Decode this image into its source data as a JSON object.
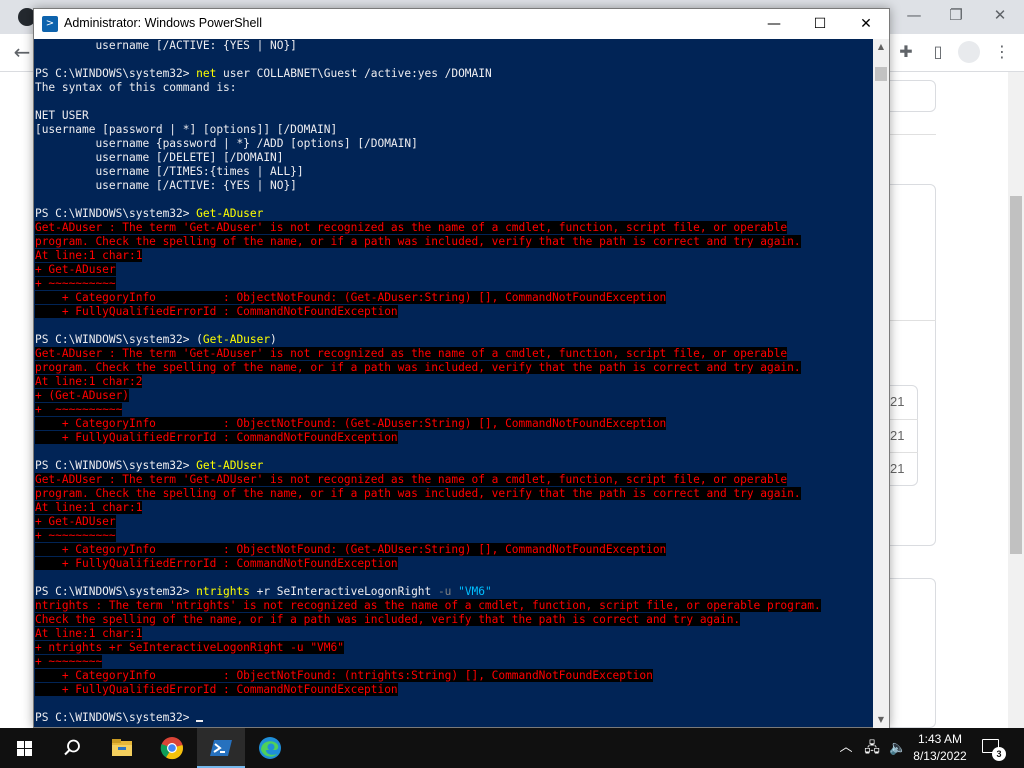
{
  "powershell": {
    "title": "Administrator: Windows PowerShell",
    "lines": [
      [
        {
          "t": "         username [/ACTIVE: {YES | NO}]",
          "c": "norm"
        }
      ],
      [
        {
          "t": "",
          "c": "norm"
        }
      ],
      [
        {
          "t": "PS C:\\WINDOWS\\system32> ",
          "c": "norm"
        },
        {
          "t": "net",
          "c": "cmd"
        },
        {
          "t": " user COLLABNET\\Guest /active:yes /DOMAIN",
          "c": "norm"
        }
      ],
      [
        {
          "t": "The syntax of this command is:",
          "c": "norm"
        }
      ],
      [
        {
          "t": "",
          "c": "norm"
        }
      ],
      [
        {
          "t": "NET USER",
          "c": "norm"
        }
      ],
      [
        {
          "t": "[username [password | *] [options]] [/DOMAIN]",
          "c": "norm"
        }
      ],
      [
        {
          "t": "         username {password | *} /ADD [options] [/DOMAIN]",
          "c": "norm"
        }
      ],
      [
        {
          "t": "         username [/DELETE] [/DOMAIN]",
          "c": "norm"
        }
      ],
      [
        {
          "t": "         username [/TIMES:{times | ALL}]",
          "c": "norm"
        }
      ],
      [
        {
          "t": "         username [/ACTIVE: {YES | NO}]",
          "c": "norm"
        }
      ],
      [
        {
          "t": "",
          "c": "norm"
        }
      ],
      [
        {
          "t": "PS C:\\WINDOWS\\system32> ",
          "c": "norm"
        },
        {
          "t": "Get-ADuser",
          "c": "cmd"
        }
      ],
      [
        {
          "t": "Get-ADuser : The term 'Get-ADuser' is not recognized as the name of a cmdlet, function, script file, or operable",
          "c": "err"
        }
      ],
      [
        {
          "t": "program. Check the spelling of the name, or if a path was included, verify that the path is correct and try again.",
          "c": "err"
        }
      ],
      [
        {
          "t": "At line:1 char:1",
          "c": "err"
        }
      ],
      [
        {
          "t": "+ Get-ADuser",
          "c": "err"
        }
      ],
      [
        {
          "t": "+ ~~~~~~~~~~",
          "c": "err"
        }
      ],
      [
        {
          "t": "    + CategoryInfo          : ObjectNotFound: (Get-ADuser:String) [], CommandNotFoundException",
          "c": "err"
        }
      ],
      [
        {
          "t": "    + FullyQualifiedErrorId : CommandNotFoundException",
          "c": "err"
        }
      ],
      [
        {
          "t": "",
          "c": "norm"
        }
      ],
      [
        {
          "t": "PS C:\\WINDOWS\\system32> (",
          "c": "norm"
        },
        {
          "t": "Get-ADuser",
          "c": "cmd"
        },
        {
          "t": ")",
          "c": "norm"
        }
      ],
      [
        {
          "t": "Get-ADuser : The term 'Get-ADuser' is not recognized as the name of a cmdlet, function, script file, or operable",
          "c": "err"
        }
      ],
      [
        {
          "t": "program. Check the spelling of the name, or if a path was included, verify that the path is correct and try again.",
          "c": "err"
        }
      ],
      [
        {
          "t": "At line:1 char:2",
          "c": "err"
        }
      ],
      [
        {
          "t": "+ (Get-ADuser)",
          "c": "err"
        }
      ],
      [
        {
          "t": "+  ~~~~~~~~~~",
          "c": "err"
        }
      ],
      [
        {
          "t": "    + CategoryInfo          : ObjectNotFound: (Get-ADuser:String) [], CommandNotFoundException",
          "c": "err"
        }
      ],
      [
        {
          "t": "    + FullyQualifiedErrorId : CommandNotFoundException",
          "c": "err"
        }
      ],
      [
        {
          "t": "",
          "c": "norm"
        }
      ],
      [
        {
          "t": "PS C:\\WINDOWS\\system32> ",
          "c": "norm"
        },
        {
          "t": "Get-ADUser",
          "c": "cmd"
        }
      ],
      [
        {
          "t": "Get-ADUser : The term 'Get-ADUser' is not recognized as the name of a cmdlet, function, script file, or operable",
          "c": "err"
        }
      ],
      [
        {
          "t": "program. Check the spelling of the name, or if a path was included, verify that the path is correct and try again.",
          "c": "err"
        }
      ],
      [
        {
          "t": "At line:1 char:1",
          "c": "err"
        }
      ],
      [
        {
          "t": "+ Get-ADUser",
          "c": "err"
        }
      ],
      [
        {
          "t": "+ ~~~~~~~~~~",
          "c": "err"
        }
      ],
      [
        {
          "t": "    + CategoryInfo          : ObjectNotFound: (Get-ADUser:String) [], CommandNotFoundException",
          "c": "err"
        }
      ],
      [
        {
          "t": "    + FullyQualifiedErrorId : CommandNotFoundException",
          "c": "err"
        }
      ],
      [
        {
          "t": "",
          "c": "norm"
        }
      ],
      [
        {
          "t": "PS C:\\WINDOWS\\system32> ",
          "c": "norm"
        },
        {
          "t": "ntrights",
          "c": "cmd"
        },
        {
          "t": " +r SeInteractiveLogonRight ",
          "c": "norm"
        },
        {
          "t": "-u",
          "c": "param"
        },
        {
          "t": " ",
          "c": "norm"
        },
        {
          "t": "\"VM6\"",
          "c": "str"
        }
      ],
      [
        {
          "t": "ntrights : The term 'ntrights' is not recognized as the name of a cmdlet, function, script file, or operable program.",
          "c": "err"
        }
      ],
      [
        {
          "t": "Check the spelling of the name, or if a path was included, verify that the path is correct and try again.",
          "c": "err"
        }
      ],
      [
        {
          "t": "At line:1 char:1",
          "c": "err"
        }
      ],
      [
        {
          "t": "+ ntrights +r SeInteractiveLogonRight -u \"VM6\"",
          "c": "err"
        }
      ],
      [
        {
          "t": "+ ~~~~~~~~",
          "c": "err"
        }
      ],
      [
        {
          "t": "    + CategoryInfo          : ObjectNotFound: (ntrights:String) [], CommandNotFoundException",
          "c": "err"
        }
      ],
      [
        {
          "t": "    + FullyQualifiedErrorId : CommandNotFoundException",
          "c": "err"
        }
      ],
      [
        {
          "t": "",
          "c": "norm"
        }
      ],
      [
        {
          "t": "PS C:\\WINDOWS\\system32> ",
          "c": "norm"
        }
      ]
    ],
    "buttons": {
      "minimize": "—",
      "maximize": "☐",
      "close": "✕"
    },
    "scroll": {
      "up": "▲",
      "down": "▼"
    },
    "colors": {
      "background": "#012456",
      "foreground": "#eeedf0",
      "error_fg": "#ff0000",
      "error_bg": "#000000",
      "command": "#ffff00",
      "parameter": "#808080",
      "string": "#00bfff"
    }
  },
  "browser": {
    "row_fragments": [
      "21",
      "21",
      "21"
    ],
    "icons": {
      "back": "back-arrow-icon",
      "extensions": "puzzle-icon",
      "side_panel": "side-panel-icon",
      "profile": "profile-icon",
      "menu": "kebab-menu-icon"
    },
    "glyphs": {
      "back": "←",
      "extensions": "✚",
      "side_panel": "▯",
      "menu": "⋮",
      "window_min": "—",
      "window_restore": "❐",
      "window_close": "✕"
    }
  },
  "taskbar": {
    "apps": [
      "start-icon",
      "search-icon",
      "file-explorer-icon",
      "chrome-icon",
      "powershell-icon",
      "edge-icon"
    ],
    "active_app": "powershell",
    "tray_glyphs": {
      "chevron": "︿",
      "network": "🖧",
      "volume": "🔈"
    },
    "time": "1:43 AM",
    "date": "8/13/2022",
    "notification_count": "3"
  }
}
